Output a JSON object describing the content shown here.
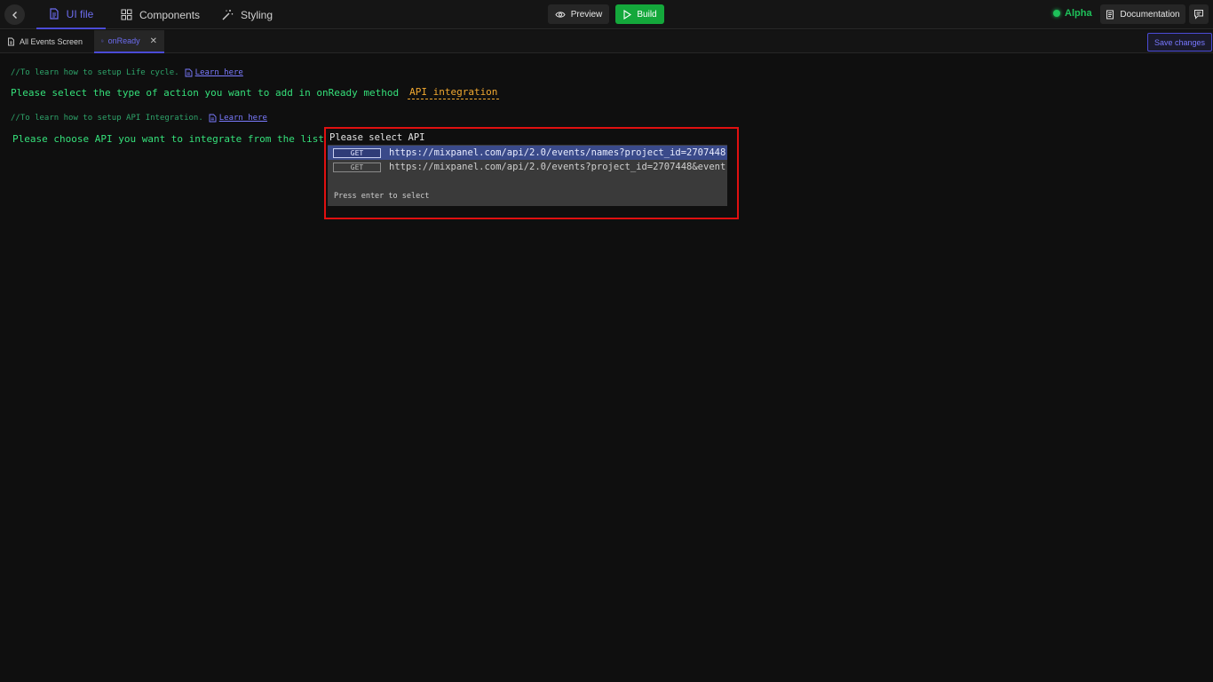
{
  "topbar": {
    "tabs": [
      {
        "label": "UI file",
        "icon": "file-icon",
        "active": true
      },
      {
        "label": "Components",
        "icon": "grid-icon",
        "active": false
      },
      {
        "label": "Styling",
        "icon": "magic-wand-icon",
        "active": false
      }
    ],
    "preview_label": "Preview",
    "build_label": "Build",
    "status_label": "Alpha",
    "docs_label": "Documentation"
  },
  "filetabs": {
    "tabs": [
      {
        "label": "All Events Screen",
        "active": false
      },
      {
        "label": "onReady",
        "active": true
      }
    ],
    "save_label": "Save changes"
  },
  "editor": {
    "comment1": "//To learn how to setup Life cycle.",
    "link1": "Learn here",
    "prompt1": "Please select the type of action you want to add in onReady method",
    "selected_action": "API integration",
    "comment2": "//To learn how to setup API Integration.",
    "link2": "Learn here",
    "prompt2": "Please choose API you want to integrate from the list"
  },
  "api_select": {
    "title": "Please select API",
    "options": [
      {
        "method": "GET",
        "url": "https://mixpanel.com/api/2.0/events/names?project_id=2707448",
        "selected": true
      },
      {
        "method": "GET",
        "url": "https://mixpanel.com/api/2.0/events?project_id=2707448&event",
        "selected": false
      }
    ],
    "hint": "Press enter to select"
  },
  "colors": {
    "accent": "#4b4bd6",
    "build": "#14a83b",
    "prompt_text": "#35e07a",
    "highlight": "#e01010"
  }
}
